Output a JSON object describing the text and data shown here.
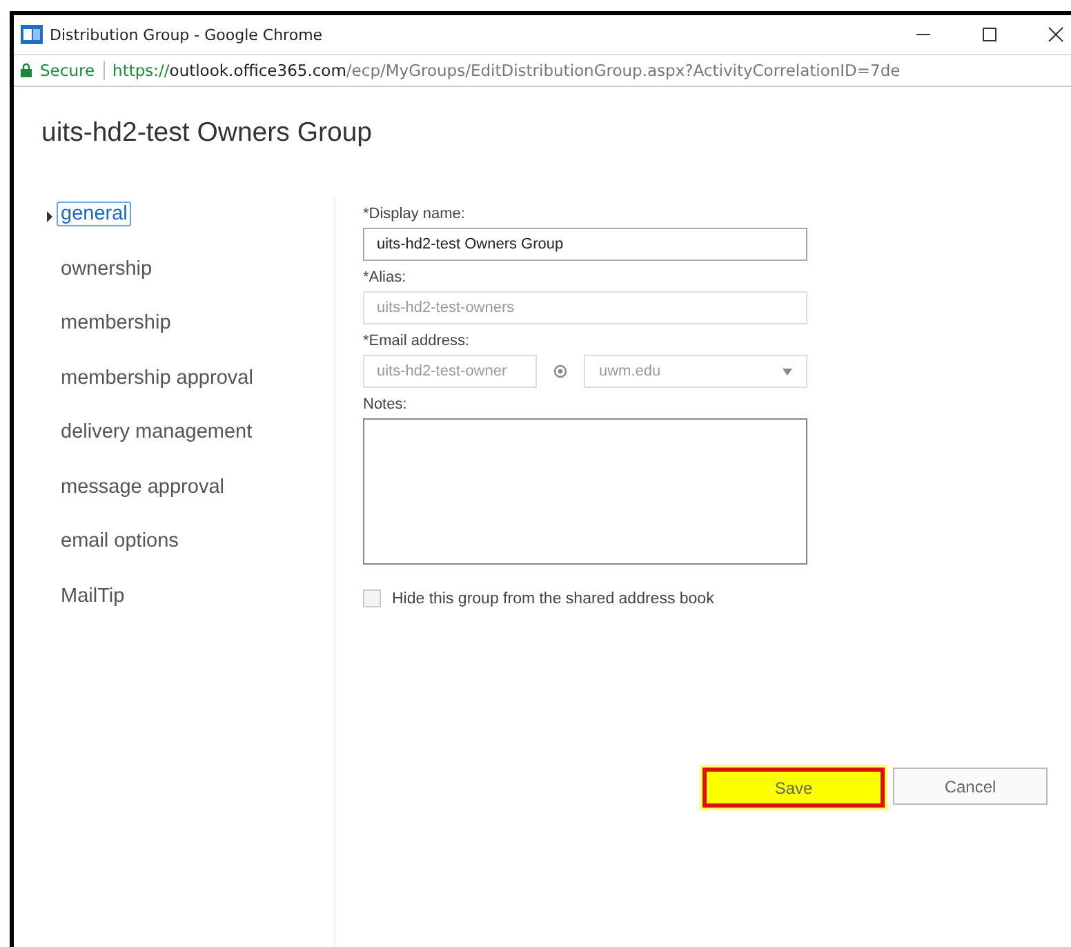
{
  "window": {
    "title": "Distribution Group - Google Chrome"
  },
  "address_bar": {
    "security": "Secure",
    "url_scheme": "https://",
    "url_host": "outlook.office365.com",
    "url_path": "/ecp/MyGroups/EditDistributionGroup.aspx?ActivityCorrelationID=7de"
  },
  "page_title": "uits-hd2-test Owners Group",
  "sidebar": {
    "items": [
      {
        "label": "general",
        "selected": true
      },
      {
        "label": "ownership",
        "selected": false
      },
      {
        "label": "membership",
        "selected": false
      },
      {
        "label": "membership approval",
        "selected": false
      },
      {
        "label": "delivery management",
        "selected": false
      },
      {
        "label": "message approval",
        "selected": false
      },
      {
        "label": "email options",
        "selected": false
      },
      {
        "label": "MailTip",
        "selected": false
      }
    ]
  },
  "form": {
    "display_name": {
      "label": "*Display name:",
      "value": "uits-hd2-test Owners Group",
      "disabled": false
    },
    "alias": {
      "label": "*Alias:",
      "value": "uits-hd2-test-owners",
      "disabled": true
    },
    "email": {
      "label": "*Email address:",
      "value": "uits-hd2-test-owner",
      "domain": "uwm.edu",
      "disabled": true
    },
    "notes": {
      "label": "Notes:"
    },
    "hide_checkbox": {
      "label": "Hide this group from the shared address book",
      "checked": false
    }
  },
  "buttons": [
    {
      "label": "Save",
      "highlighted": true
    },
    {
      "label": "Cancel",
      "highlighted": false
    }
  ]
}
